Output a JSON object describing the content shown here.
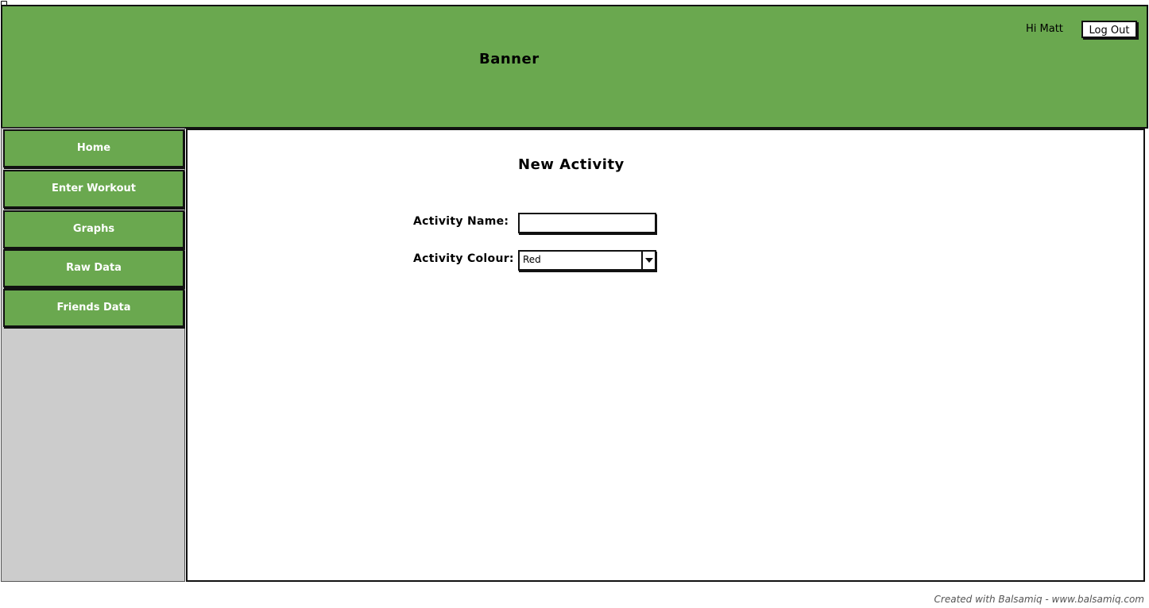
{
  "header": {
    "banner_title": "Banner",
    "greeting": "Hi Matt",
    "logout_label": "Log Out"
  },
  "sidebar": {
    "items": [
      {
        "label": "Home"
      },
      {
        "label": "Enter Workout"
      },
      {
        "label": "Graphs"
      },
      {
        "label": "Raw Data"
      },
      {
        "label": "Friends Data"
      }
    ]
  },
  "main": {
    "title": "New Activity",
    "form": {
      "name_label": "Activity Name:",
      "name_value": "",
      "colour_label": "Activity Colour:",
      "colour_selected": "Red"
    }
  },
  "footer": {
    "note": "Created with Balsamiq - www.balsamiq.com"
  },
  "colors": {
    "banner": "#6aa84f",
    "nav_item": "#6aa84f",
    "sidebar_bg": "#cccccc",
    "content_bg": "#ffffff",
    "border": "#111111"
  },
  "icons": {
    "select_arrow": "chevron-down-icon"
  }
}
